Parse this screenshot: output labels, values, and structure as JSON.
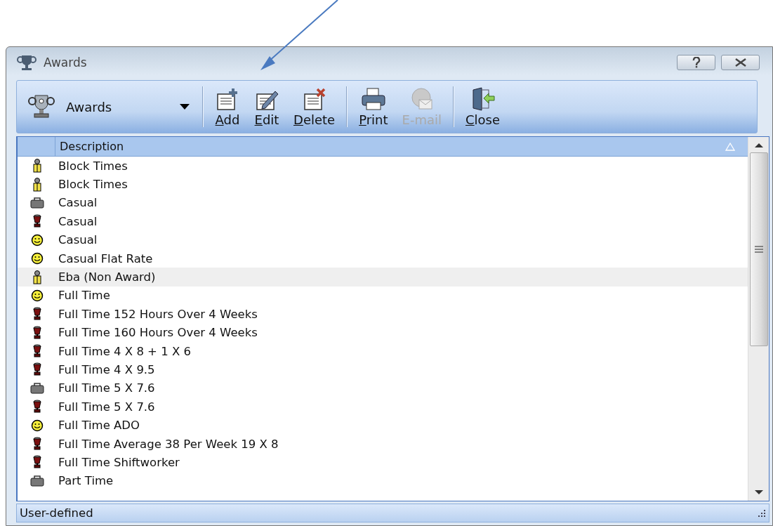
{
  "window": {
    "title": "Awards"
  },
  "toolbar": {
    "selector": {
      "label": "Awards"
    },
    "buttons": [
      {
        "label": "Add",
        "kind": "add",
        "accelerator": true,
        "disabled": false
      },
      {
        "label": "Edit",
        "kind": "edit",
        "accelerator": true,
        "disabled": false
      },
      {
        "label": "Delete",
        "kind": "delete",
        "accelerator": true,
        "disabled": false
      },
      {
        "label": "Print",
        "kind": "print",
        "accelerator": true,
        "disabled": false
      },
      {
        "label": "E-mail",
        "kind": "email",
        "accelerator": false,
        "disabled": true
      },
      {
        "label": "Close",
        "kind": "close",
        "accelerator": true,
        "disabled": false
      }
    ]
  },
  "table": {
    "columns": [
      "Description"
    ],
    "rows": [
      {
        "description": "Block Times",
        "kind": "person",
        "selected": false
      },
      {
        "description": "Block Times",
        "kind": "person",
        "selected": false
      },
      {
        "description": "Casual",
        "kind": "briefcase",
        "selected": false
      },
      {
        "description": "Casual",
        "kind": "cup",
        "selected": false
      },
      {
        "description": "Casual",
        "kind": "smiley",
        "selected": false
      },
      {
        "description": "Casual Flat Rate",
        "kind": "smiley",
        "selected": false
      },
      {
        "description": "Eba (Non Award)",
        "kind": "person",
        "selected": true
      },
      {
        "description": "Full Time",
        "kind": "smiley",
        "selected": false
      },
      {
        "description": "Full Time 152 Hours Over 4 Weeks",
        "kind": "cup",
        "selected": false
      },
      {
        "description": "Full Time 160 Hours Over 4 Weeks",
        "kind": "cup",
        "selected": false
      },
      {
        "description": "Full Time 4 X 8 + 1 X 6",
        "kind": "cup",
        "selected": false
      },
      {
        "description": "Full Time 4 X 9.5",
        "kind": "cup",
        "selected": false
      },
      {
        "description": "Full Time 5 X 7.6",
        "kind": "briefcase",
        "selected": false
      },
      {
        "description": "Full Time 5 X 7.6",
        "kind": "cup",
        "selected": false
      },
      {
        "description": "Full Time ADO",
        "kind": "smiley",
        "selected": false
      },
      {
        "description": "Full Time Average 38 Per Week 19 X 8",
        "kind": "cup",
        "selected": false
      },
      {
        "description": "Full Time Shiftworker",
        "kind": "cup",
        "selected": false
      },
      {
        "description": "Part Time",
        "kind": "briefcase",
        "selected": false
      }
    ]
  },
  "status_bar": {
    "text": "User-defined"
  }
}
